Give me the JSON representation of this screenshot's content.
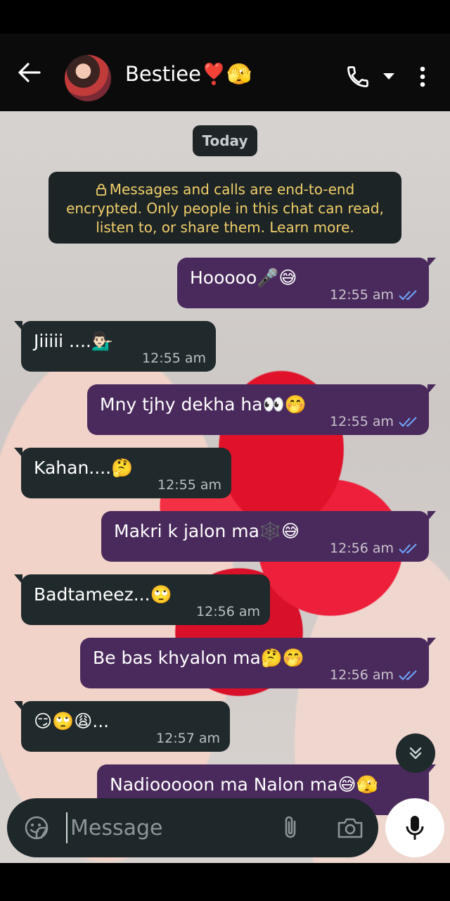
{
  "header": {
    "contact_name": "Bestiee❣️🫣",
    "icons": [
      "back-arrow-icon",
      "phone-icon",
      "caret-down-icon",
      "more-vert-icon"
    ]
  },
  "chat": {
    "date_chip": "Today",
    "encryption_notice": "Messages and calls are end-to-end encrypted. Only people in this chat can read, listen to, or share them. Learn more.",
    "messages": [
      {
        "direction": "out",
        "text": "Hooooo🎤😅",
        "time": "12:55 am",
        "status": "read"
      },
      {
        "direction": "in",
        "text": "Jiiiii ....💁🏻‍♂️",
        "time": "12:55 am"
      },
      {
        "direction": "out",
        "text": "Mny tjhy dekha ha👀🤭",
        "time": "12:55 am",
        "status": "read"
      },
      {
        "direction": "in",
        "text": "Kahan....🤔",
        "time": "12:55 am"
      },
      {
        "direction": "out",
        "text": "Makri k jalon ma🕸️😅",
        "time": "12:56 am",
        "status": "read"
      },
      {
        "direction": "in",
        "text": "Badtameez...🙄",
        "time": "12:56 am"
      },
      {
        "direction": "out",
        "text": "Be bas khyalon ma🤔🤭",
        "time": "12:56 am",
        "status": "read"
      },
      {
        "direction": "in",
        "text": "😏🙄😩...",
        "time": "12:57 am"
      },
      {
        "direction": "out",
        "text": "Nadiooooon ma     Nalon ma😅🫣",
        "time": "",
        "status": ""
      }
    ]
  },
  "composer": {
    "placeholder": "Message"
  },
  "colors": {
    "outgoing_bubble": "#4a2a5c",
    "incoming_bubble": "#202a2c",
    "read_tick": "#6fa8ff",
    "encryption_text": "#f2cf6a"
  }
}
